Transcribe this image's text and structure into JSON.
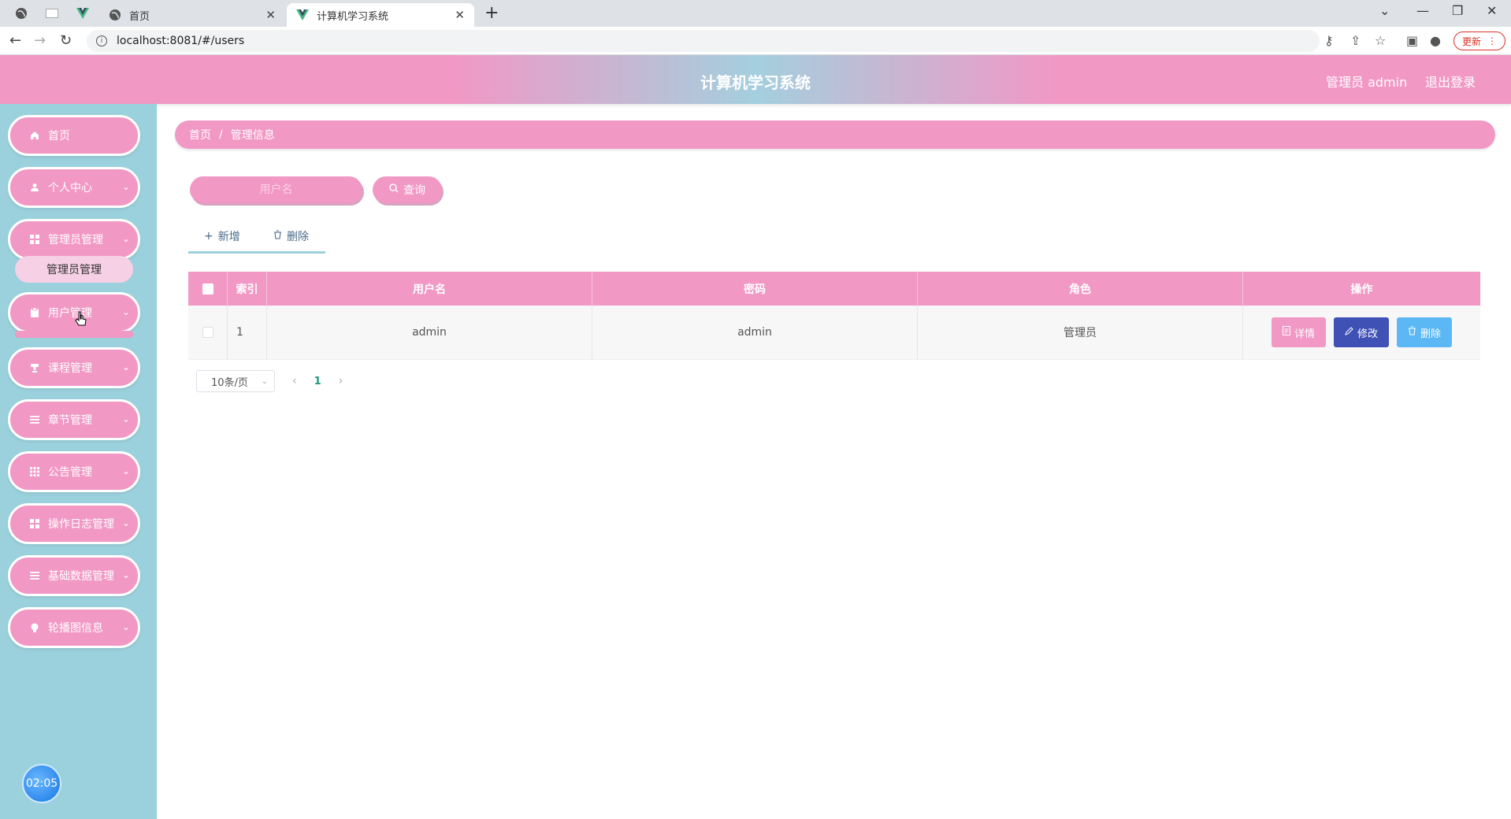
{
  "browser": {
    "tabs": [
      {
        "label": "首页"
      },
      {
        "label": "计算机学习系统"
      }
    ],
    "url": "localhost:8081/#/users",
    "update_label": "更新"
  },
  "header": {
    "title": "计算机学习系统",
    "user_label": "管理员 admin",
    "logout_label": "退出登录"
  },
  "sidebar": {
    "items": [
      {
        "label": "首页",
        "icon": "home-icon"
      },
      {
        "label": "个人中心",
        "icon": "user-icon"
      },
      {
        "label": "管理员管理",
        "icon": "grid-icon"
      },
      {
        "label": "用户管理",
        "icon": "clipboard-icon"
      },
      {
        "label": "课程管理",
        "icon": "cup-icon"
      },
      {
        "label": "章节管理",
        "icon": "list-icon"
      },
      {
        "label": "公告管理",
        "icon": "apps-icon"
      },
      {
        "label": "操作日志管理",
        "icon": "grid-icon"
      },
      {
        "label": "基础数据管理",
        "icon": "list-icon"
      },
      {
        "label": "轮播图信息",
        "icon": "bulb-icon"
      }
    ],
    "submenu_label": "管理员管理",
    "clock": "02:05"
  },
  "breadcrumb": {
    "home": "首页",
    "current": "管理信息"
  },
  "search": {
    "placeholder": "用户名",
    "button_label": "查询"
  },
  "actions": {
    "add_label": "新增",
    "delete_label": "删除"
  },
  "table": {
    "headers": [
      "索引",
      "用户名",
      "密码",
      "角色",
      "操作"
    ],
    "rows": [
      {
        "index": "1",
        "username": "admin",
        "password": "admin",
        "role": "管理员"
      }
    ],
    "row_buttons": {
      "detail": "详情",
      "edit": "修改",
      "delete": "删除"
    }
  },
  "pagination": {
    "page_size": "10条/页",
    "current_page": "1"
  },
  "colors": {
    "primary_pink": "#f198c5",
    "sidebar_teal": "#9bd1dc",
    "edit_blue": "#3f51b5",
    "delete_blue": "#5cb8f5"
  }
}
